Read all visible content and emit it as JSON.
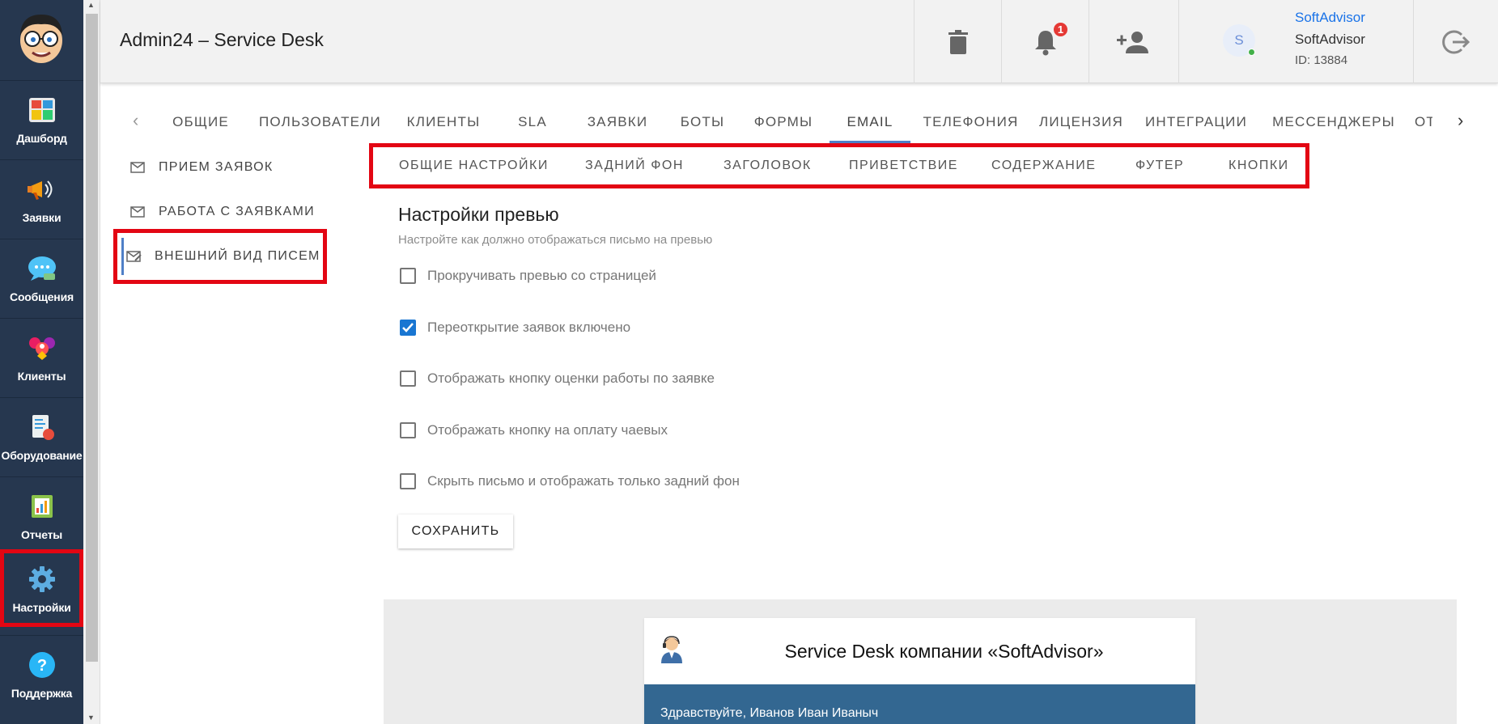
{
  "app": {
    "title": "Admin24 – Service Desk"
  },
  "leftnav": {
    "items": [
      {
        "label": "Дашборд",
        "icon": "dashboard-icon"
      },
      {
        "label": "Заявки",
        "icon": "megaphone-icon"
      },
      {
        "label": "Сообщения",
        "icon": "chat-bubble-icon"
      },
      {
        "label": "Клиенты",
        "icon": "clients-icon"
      },
      {
        "label": "Оборудование",
        "icon": "equipment-icon"
      },
      {
        "label": "Отчеты",
        "icon": "reports-icon"
      },
      {
        "label": "Настройки",
        "icon": "gear-icon",
        "selected": true
      },
      {
        "label": "Поддержка",
        "icon": "help-icon"
      }
    ]
  },
  "header": {
    "notifications_count": "1",
    "user": {
      "avatar_letter": "S",
      "name": "SoftAdvisor",
      "company": "SoftAdvisor",
      "id": "ID: 13884"
    }
  },
  "main_tabs": {
    "items": [
      "Общие",
      "Пользователи",
      "Клиенты",
      "SLA",
      "Заявки",
      "Боты",
      "Формы",
      "Email",
      "Телефония",
      "Лицензия",
      "Интеграции",
      "Мессенджеры",
      "От"
    ],
    "active": "Email"
  },
  "side_menu": {
    "items": [
      "Прием заявок",
      "Работа с заявками",
      "Внешний вид писем"
    ],
    "active": "Внешний вид писем"
  },
  "sub_tabs": {
    "items": [
      "Общие настройки",
      "Задний фон",
      "Заголовок",
      "Приветствие",
      "Содержание",
      "Футер",
      "Кнопки"
    ]
  },
  "content": {
    "title": "Настройки превью",
    "subtitle": "Настройте как должно отображаться письмо на превью",
    "options": [
      {
        "label": "Прокручивать превью со страницей",
        "checked": false
      },
      {
        "label": "Переоткрытие заявок включено",
        "checked": true
      },
      {
        "label": "Отображать кнопку оценки работы по заявке",
        "checked": false
      },
      {
        "label": "Отображать кнопку на оплату чаевых",
        "checked": false
      },
      {
        "label": "Скрыть письмо и отображать только задний фон",
        "checked": false
      }
    ],
    "save_label": "Сохранить"
  },
  "preview": {
    "header_title": "Service Desk компании «SoftAdvisor»",
    "greeting": "Здравствуйте, Иванов Иван Иваныч"
  },
  "colors": {
    "nav_bg": "#26374f",
    "accent": "#4f7fc7",
    "highlight": "#e30613",
    "checkbox": "#1976d2",
    "preview_band": "#336791"
  }
}
